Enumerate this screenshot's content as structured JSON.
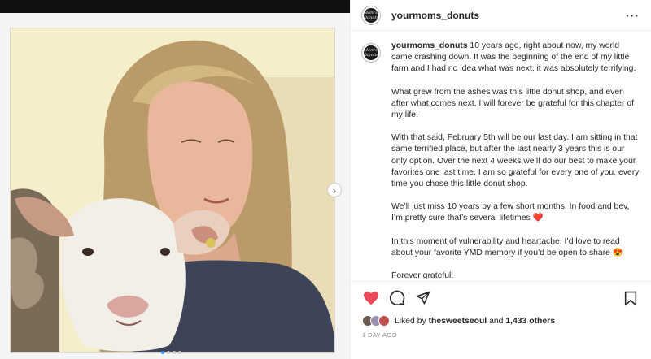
{
  "post": {
    "username": "yourmoms_donuts",
    "avatar_text": "Mom's Donuts",
    "more_icon": "more-horizontal-icon",
    "carousel": {
      "next_icon": "›",
      "dots": 4,
      "active_dot": 0
    }
  },
  "caption": {
    "username": "yourmoms_donuts",
    "paragraphs": [
      "10 years ago, right about now, my world came crashing down. It was the beginning of the end of my little farm and I had no idea what was next, it was absolutely terrifying.",
      "What grew from the ashes was this little donut shop, and even after what comes next, I will forever be grateful for this chapter of my life.",
      "With that said, February 5th will be our last day. I am sitting in that same terrified place, but after the last nearly 3 years this is our only option. Over the next 4 weeks we’ll do our best to make your favorites one last time. I am so grateful for every one of you, every time you chose this little donut shop.",
      "We’ll just miss 10 years by a few short months. In food and bev, I’m pretty sure that’s several lifetimes ❤️",
      "In this moment of vulnerability and heartache, I’d love to read about your favorite YMD memory if you’d be open to share 😍",
      "Forever grateful."
    ]
  },
  "actions": {
    "like_icon": "heart-icon",
    "comment_icon": "comment-icon",
    "share_icon": "share-icon",
    "save_icon": "bookmark-icon",
    "like_color": "#ed4956"
  },
  "likes": {
    "prefix": "Liked by",
    "user": "thesweetseoul",
    "conjunction": "and",
    "others": "1,433 others"
  },
  "timestamp": "1 DAY AGO"
}
